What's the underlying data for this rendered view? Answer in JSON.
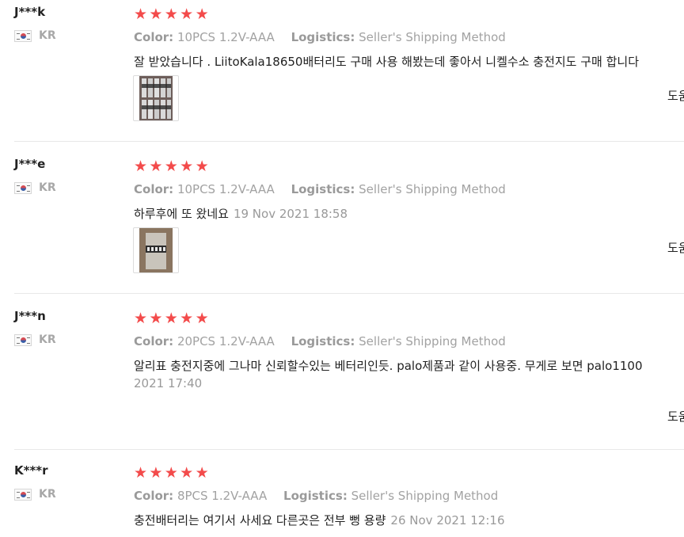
{
  "labels": {
    "color": "Color:",
    "logistics": "Logistics:"
  },
  "star_color": "#f34b4b",
  "reviews": [
    {
      "user": "J***k",
      "country": "KR",
      "rating": 5,
      "color": "10PCS 1.2V-AAA",
      "logistics": "Seller's Shipping Method",
      "text": "잘 받았습니다 . LiitoKala18650배터리도 구매 사용 해봤는데 좋아서 니켈수소 충전지도 구매 합니다",
      "date": "",
      "helpful": "도움"
    },
    {
      "user": "J***e",
      "country": "KR",
      "rating": 5,
      "color": "10PCS 1.2V-AAA",
      "logistics": "Seller's Shipping Method",
      "text": "하루후에 또 왔네요",
      "date": "19 Nov 2021 18:58",
      "helpful": "도움"
    },
    {
      "user": "J***n",
      "country": "KR",
      "rating": 5,
      "color": "20PCS 1.2V-AAA",
      "logistics": "Seller's Shipping Method",
      "text": "알리표 충전지중에 그나마 신뢰할수있는 베터리인듯. palo제품과 같이 사용중. 무게로 보면 palo1100",
      "date": "2021 17:40",
      "helpful": "도움"
    },
    {
      "user": "K***r",
      "country": "KR",
      "rating": 5,
      "color": "8PCS 1.2V-AAA",
      "logistics": "Seller's Shipping Method",
      "text": "충전배터리는 여기서 사세요 다른곳은 전부 뻥 용량",
      "date": "26 Nov 2021 12:16",
      "helpful": ""
    }
  ]
}
